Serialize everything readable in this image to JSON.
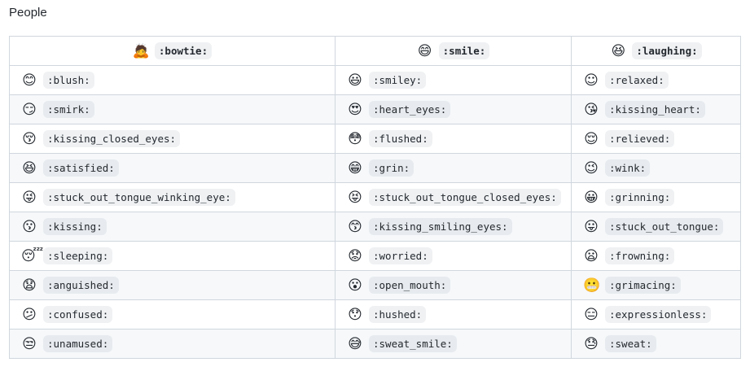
{
  "page": {
    "title": "People"
  },
  "table": {
    "header": [
      {
        "emoji": "🙇",
        "code": ":bowtie:"
      },
      {
        "emoji": "😄",
        "code": ":smile:"
      },
      {
        "emoji": "😆",
        "code": ":laughing:"
      }
    ],
    "rows": [
      [
        {
          "emoji": "😊",
          "code": ":blush:"
        },
        {
          "emoji": "😃",
          "code": ":smiley:"
        },
        {
          "emoji": "☺",
          "code": ":relaxed:"
        }
      ],
      [
        {
          "emoji": "😏",
          "code": ":smirk:"
        },
        {
          "emoji": "😍",
          "code": ":heart_eyes:"
        },
        {
          "emoji": "😘",
          "code": ":kissing_heart:"
        }
      ],
      [
        {
          "emoji": "😚",
          "code": ":kissing_closed_eyes:"
        },
        {
          "emoji": "😳",
          "code": ":flushed:"
        },
        {
          "emoji": "😌",
          "code": ":relieved:"
        }
      ],
      [
        {
          "emoji": "😆",
          "code": ":satisfied:"
        },
        {
          "emoji": "😁",
          "code": ":grin:"
        },
        {
          "emoji": "😉",
          "code": ":wink:"
        }
      ],
      [
        {
          "emoji": "😜",
          "code": ":stuck_out_tongue_winking_eye:"
        },
        {
          "emoji": "😝",
          "code": ":stuck_out_tongue_closed_eyes:"
        },
        {
          "emoji": "😀",
          "code": ":grinning:"
        }
      ],
      [
        {
          "emoji": "😗",
          "code": ":kissing:"
        },
        {
          "emoji": "😙",
          "code": ":kissing_smiling_eyes:"
        },
        {
          "emoji": "😛",
          "code": ":stuck_out_tongue:"
        }
      ],
      [
        {
          "emoji": "😴",
          "code": ":sleeping:"
        },
        {
          "emoji": "😟",
          "code": ":worried:"
        },
        {
          "emoji": "😦",
          "code": ":frowning:"
        }
      ],
      [
        {
          "emoji": "😧",
          "code": ":anguished:"
        },
        {
          "emoji": "😮",
          "code": ":open_mouth:"
        },
        {
          "emoji": "😬",
          "code": ":grimacing:"
        }
      ],
      [
        {
          "emoji": "😕",
          "code": ":confused:"
        },
        {
          "emoji": "😯",
          "code": ":hushed:"
        },
        {
          "emoji": "😑",
          "code": ":expressionless:"
        }
      ],
      [
        {
          "emoji": "😒",
          "code": ":unamused:"
        },
        {
          "emoji": "😅",
          "code": ":sweat_smile:"
        },
        {
          "emoji": "😓",
          "code": ":sweat:"
        }
      ]
    ]
  },
  "colors": {
    "border": "#d0d7de",
    "stripe": "#f6f8fa",
    "code_bg": "#eff1f3",
    "text": "#24292f"
  }
}
